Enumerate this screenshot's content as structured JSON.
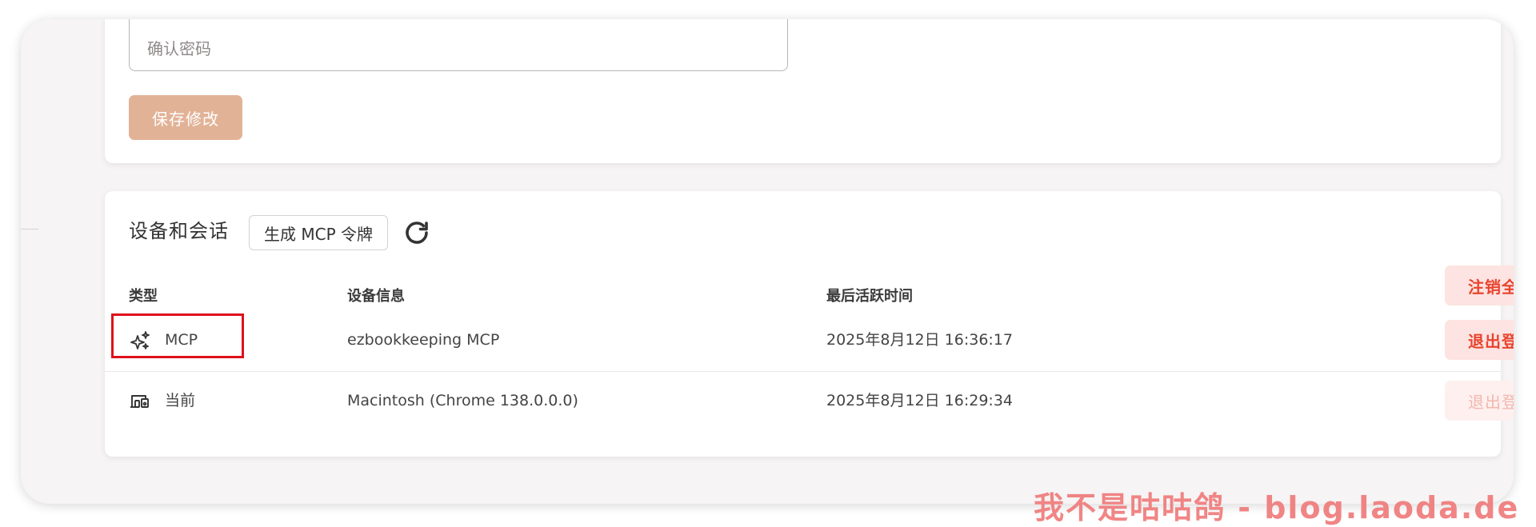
{
  "password_form": {
    "confirm_password_placeholder": "确认密码",
    "save_label": "保存修改"
  },
  "sessions": {
    "title": "设备和会话",
    "generate_token_label": "生成 MCP 令牌",
    "refresh_icon": "refresh-icon",
    "columns": {
      "type": "类型",
      "device_info": "设备信息",
      "last_active": "最后活跃时间"
    },
    "revoke_all_label": "注销全部",
    "rows": [
      {
        "icon": "sparkles-icon",
        "type": "MCP",
        "device_info": "ezbookkeeping MCP",
        "last_active": "2025年8月12日 16:36:17",
        "action_label": "退出登录",
        "action_enabled": true
      },
      {
        "icon": "devices-icon",
        "type": "当前",
        "device_info": "Macintosh (Chrome 138.0.0.0)",
        "last_active": "2025年8月12日 16:29:34",
        "action_label": "退出登录",
        "action_enabled": false
      }
    ]
  },
  "watermark": "我不是咕咕鸽 - blog.laoda.de",
  "colors": {
    "primary": "#e2b297",
    "danger": "#e8442e",
    "danger_bg": "#fde3e1",
    "highlight_box": "#e0101a",
    "watermark": "#f07b7b"
  }
}
